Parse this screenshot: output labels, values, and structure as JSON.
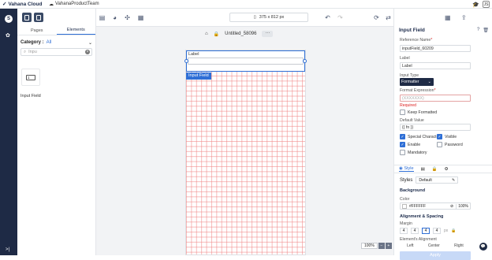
{
  "app": {
    "brand": "Vahana Cloud",
    "workspace_tab": "VahanaProductTeam",
    "avatar_initials": "JS",
    "brand_color": "#1e2a45",
    "accent": "#2f6fd6"
  },
  "rail": {
    "workspace_initial": "S",
    "expand_glyph": ">|"
  },
  "left_panel": {
    "tabs": [
      "Pages",
      "Elements"
    ],
    "active_tab": "Elements",
    "category_label": "Category :",
    "category_value": "All",
    "search": {
      "value": "Inpu"
    },
    "element": {
      "label": "Input Field",
      "preview": "1"
    }
  },
  "toolbar": {
    "device_size": "375 x 812 px"
  },
  "canvas": {
    "page_name": "Untitled_58096",
    "more": "···",
    "field_label": "Label",
    "selected_tag": "Input Field",
    "zoom": "100%",
    "zoom_minus": "−",
    "zoom_plus": "+"
  },
  "props": {
    "title": "Input Field",
    "reference_name_label": "Reference Name",
    "reference_name_value": "inputField_60209",
    "label_label": "Label",
    "label_value": "Label",
    "input_type_label": "Input Type",
    "input_type_value": "Formatter",
    "format_expression_label": "Format Expression",
    "format_expression_placeholder": "(XXXXXXX)",
    "required_msg": "Required",
    "keep_formatted": "Keep Formatted",
    "default_value_label": "Default Value",
    "default_value": "{{ fn }}",
    "checkboxes": [
      {
        "label": "Special Characters",
        "checked": true
      },
      {
        "label": "Visible",
        "checked": true
      },
      {
        "label": "Enable",
        "checked": true
      },
      {
        "label": "Password",
        "checked": false
      },
      {
        "label": "Mandatory",
        "checked": false
      }
    ],
    "style_tab": "Style",
    "styles_label": "Styles",
    "styles_value": "Default",
    "background_label": "Background",
    "color_label": "Color",
    "color_value": "#FFFFFF",
    "opacity": "100%",
    "alignment_label": "Alignment & Spacing",
    "margin_label": "Margin",
    "margins": [
      "4",
      "4",
      "4",
      "4"
    ],
    "margin_unit": "px",
    "element_alignment_label": "Element's Alignment",
    "alignment_options": [
      "Left",
      "Center",
      "Right"
    ],
    "apply": "Apply"
  }
}
